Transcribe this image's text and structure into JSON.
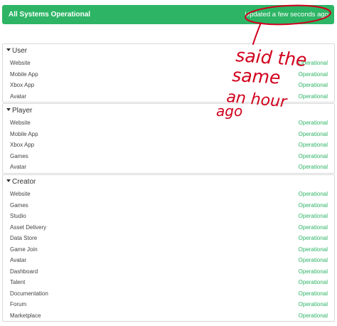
{
  "banner": {
    "title": "All Systems Operational",
    "updated": "Updated a few seconds ago",
    "color": "#2db565"
  },
  "groups": [
    {
      "name": "User",
      "services": [
        {
          "name": "Website",
          "status": "Operational"
        },
        {
          "name": "Mobile App",
          "status": "Operational"
        },
        {
          "name": "Xbox App",
          "status": "Operational"
        },
        {
          "name": "Avatar",
          "status": "Operational"
        }
      ]
    },
    {
      "name": "Player",
      "services": [
        {
          "name": "Website",
          "status": "Operational"
        },
        {
          "name": "Mobile App",
          "status": "Operational"
        },
        {
          "name": "Xbox App",
          "status": "Operational"
        },
        {
          "name": "Games",
          "status": "Operational"
        },
        {
          "name": "Avatar",
          "status": "Operational"
        }
      ]
    },
    {
      "name": "Creator",
      "services": [
        {
          "name": "Website",
          "status": "Operational"
        },
        {
          "name": "Games",
          "status": "Operational"
        },
        {
          "name": "Studio",
          "status": "Operational"
        },
        {
          "name": "Asset Delivery",
          "status": "Operational"
        },
        {
          "name": "Data Store",
          "status": "Operational"
        },
        {
          "name": "Game Join",
          "status": "Operational"
        },
        {
          "name": "Avatar",
          "status": "Operational"
        },
        {
          "name": "Dashboard",
          "status": "Operational"
        },
        {
          "name": "Talent",
          "status": "Operational"
        },
        {
          "name": "Documentation",
          "status": "Operational"
        },
        {
          "name": "Forum",
          "status": "Operational"
        },
        {
          "name": "Marketplace",
          "status": "Operational"
        }
      ]
    }
  ],
  "annotation": {
    "lines": [
      "said the",
      "same",
      "an hour",
      "ago"
    ],
    "color": "#d1001c"
  }
}
